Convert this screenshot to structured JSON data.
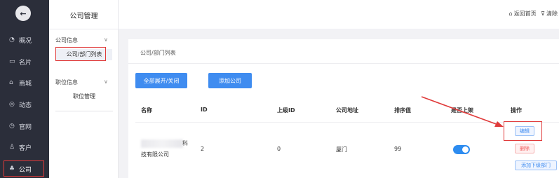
{
  "nav": {
    "logo": "←",
    "items": [
      {
        "icon": "◔",
        "label": "概况"
      },
      {
        "icon": "▭",
        "label": "名片"
      },
      {
        "icon": "⌂",
        "label": "商城"
      },
      {
        "icon": "◎",
        "label": "动态"
      },
      {
        "icon": "◷",
        "label": "官网"
      },
      {
        "icon": "♙",
        "label": "客户"
      },
      {
        "icon": "♣",
        "label": "公司"
      }
    ]
  },
  "subnav": {
    "title": "公司管理",
    "groups": [
      {
        "label": "公司信息",
        "chevron": "∨",
        "items": [
          "公司/部门列表"
        ]
      },
      {
        "label": "职位信息",
        "chevron": "∨",
        "items": [
          "职位管理"
        ]
      }
    ]
  },
  "topbar": {
    "home_icon": "⌂",
    "home_label": "返回首页",
    "clear_icon": "⊽",
    "clear_label": "清除"
  },
  "breadcrumb": "公司/部门列表",
  "buttons": {
    "expand": "全部展开/关闭",
    "add_company": "添加公司"
  },
  "table": {
    "headers": [
      "名称",
      "ID",
      "上级ID",
      "公司地址",
      "排序值",
      "是否上架",
      "操作"
    ],
    "rows": [
      {
        "name_line1": "科",
        "name_line2": "技有限公司",
        "id": "2",
        "parent_id": "0",
        "address": "厦门",
        "sort": "99",
        "listed": true,
        "actions": [
          "编辑",
          "删除",
          "添加下级部门"
        ]
      }
    ]
  },
  "colors": {
    "nav_bg": "#2b2e3a",
    "primary": "#3f8cf0",
    "highlight": "#e03a3a",
    "danger": "#f05656"
  }
}
